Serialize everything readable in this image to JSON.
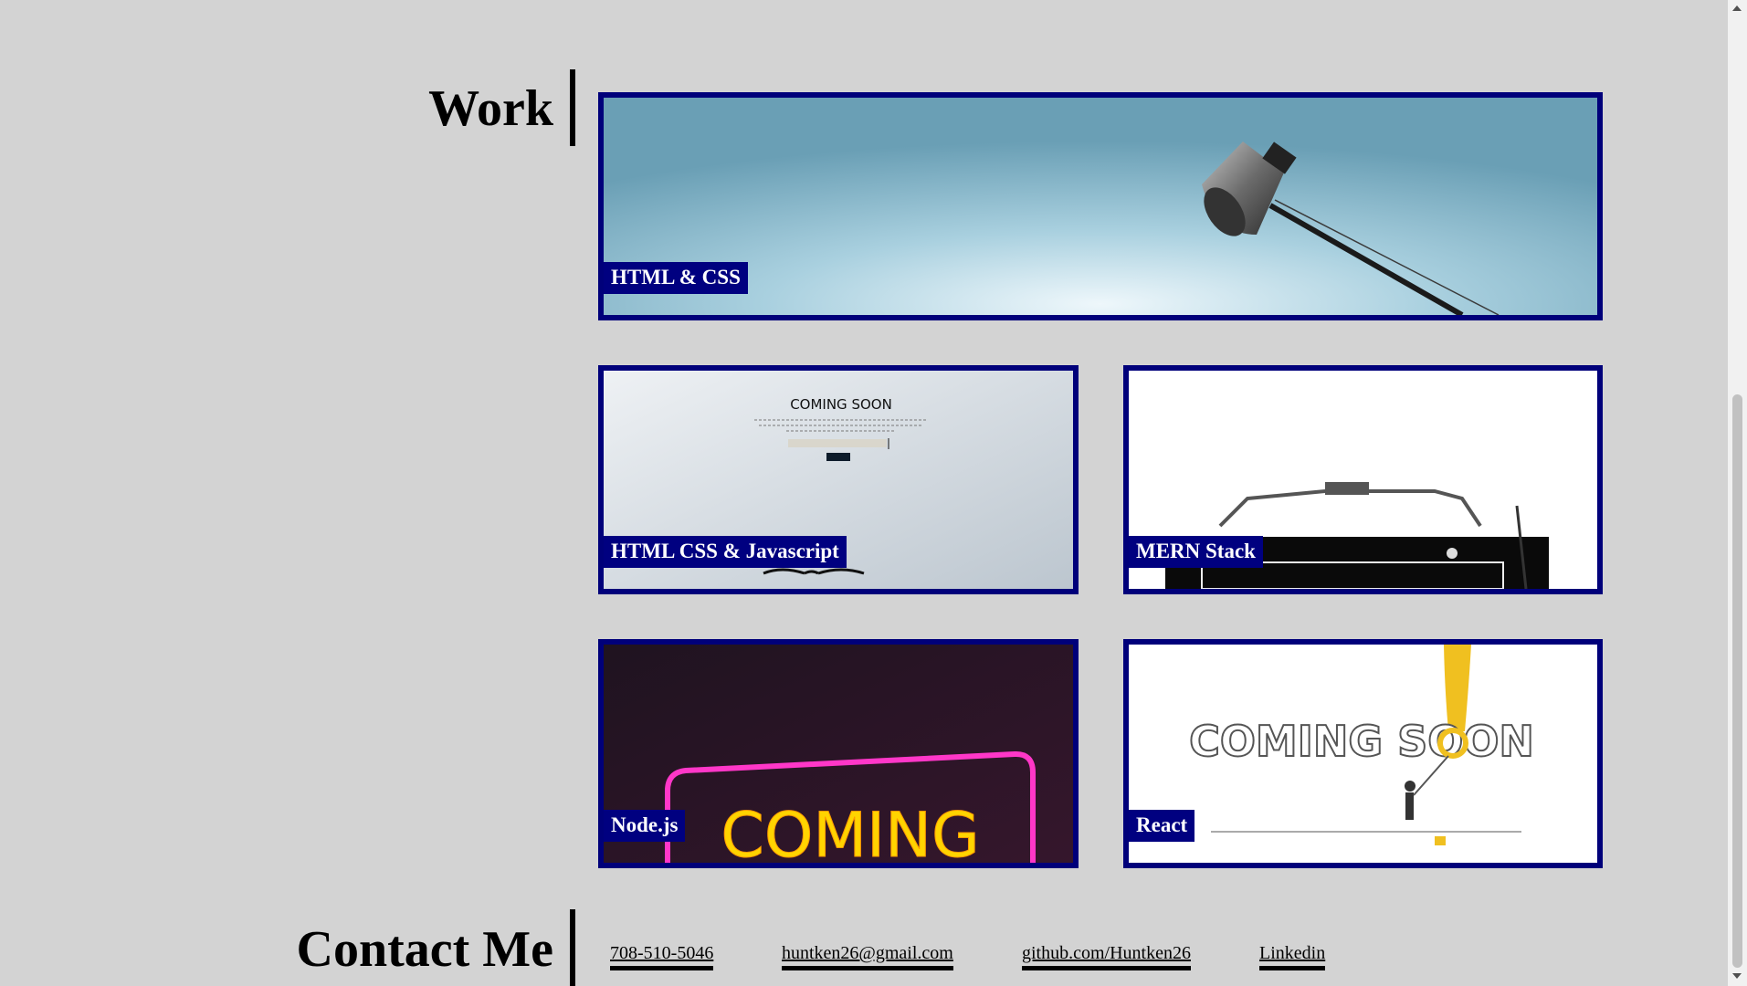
{
  "work": {
    "heading": "Work",
    "projects": [
      {
        "label": "HTML & CSS",
        "image": "desk-lamp"
      },
      {
        "label": "HTML CSS & Javascript",
        "image": "coming-soon-page"
      },
      {
        "label": "MERN Stack",
        "image": "typewriter"
      },
      {
        "label": "Node.js",
        "image": "neon-coming-sign"
      },
      {
        "label": "React",
        "image": "coming-soon-painter"
      }
    ]
  },
  "thumb_text": {
    "coming_soon_page_title": "COMING SOON",
    "neon_text": "COMING",
    "painter_text": "COMING SOON"
  },
  "contact": {
    "heading": "Contact Me",
    "links": [
      {
        "label": "708-510-5046"
      },
      {
        "label": "huntken26@gmail.com"
      },
      {
        "label": "github.com/Huntken26"
      },
      {
        "label": "Linkedin"
      }
    ]
  },
  "colors": {
    "background": "#d3d3d3",
    "card_border": "#00007a",
    "label_bg": "#000080",
    "label_text": "#ffffff"
  }
}
